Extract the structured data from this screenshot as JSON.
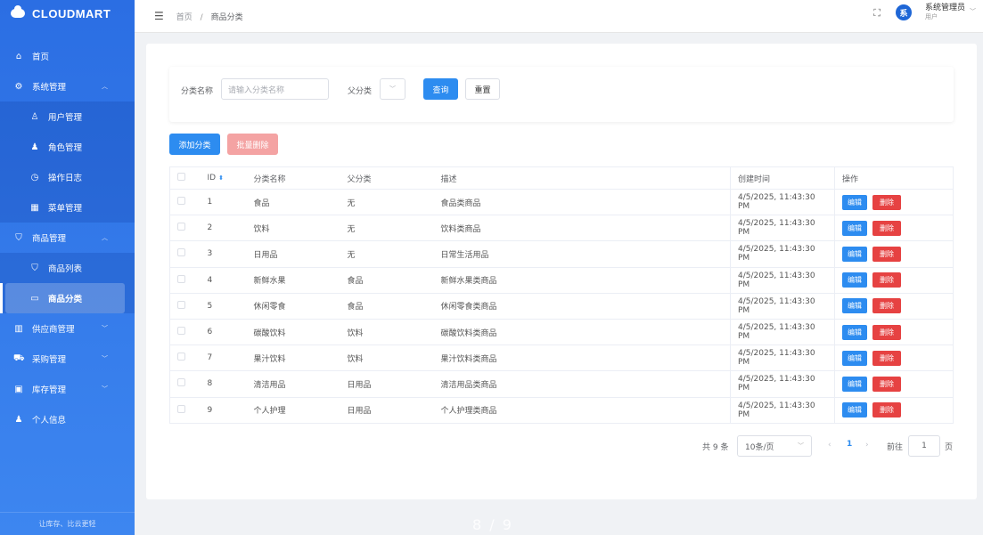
{
  "app": {
    "logo": "CLOUDMART",
    "footer": "让库存、比云更轻"
  },
  "sidebar": {
    "items": [
      {
        "label": "首页",
        "icon": "home-icon"
      },
      {
        "label": "系统管理",
        "icon": "gear-icon"
      },
      {
        "label": "用户管理",
        "icon": "user-outline-icon"
      },
      {
        "label": "角色管理",
        "icon": "user-filled-icon"
      },
      {
        "label": "操作日志",
        "icon": "timer-icon"
      },
      {
        "label": "菜单管理",
        "icon": "grid-icon"
      },
      {
        "label": "商品管理",
        "icon": "bag-icon"
      },
      {
        "label": "商品列表",
        "icon": "bag-outline-icon"
      },
      {
        "label": "商品分类",
        "icon": "folder-icon"
      },
      {
        "label": "供应商管理",
        "icon": "building-icon"
      },
      {
        "label": "采购管理",
        "icon": "cart-icon"
      },
      {
        "label": "库存管理",
        "icon": "box-icon"
      },
      {
        "label": "个人信息",
        "icon": "person-icon"
      }
    ]
  },
  "header": {
    "breadcrumb_home": "首页",
    "breadcrumb_sep": "/",
    "breadcrumb_current": "商品分类",
    "avatar_char": "系",
    "user_name": "系统管理员",
    "user_role": "用户"
  },
  "filter": {
    "name_label": "分类名称",
    "name_placeholder": "请输入分类名称",
    "parent_label": "父分类",
    "query_btn": "查询",
    "reset_btn": "重置"
  },
  "actions": {
    "add": "添加分类",
    "batch_delete": "批量删除"
  },
  "table": {
    "headers": [
      "ID",
      "分类名称",
      "父分类",
      "描述",
      "创建时间",
      "操作"
    ],
    "edit_label": "编辑",
    "delete_label": "删除",
    "rows": [
      {
        "id": "1",
        "name": "食品",
        "parent": "无",
        "desc": "食品类商品",
        "created": "4/5/2025, 11:43:30 PM"
      },
      {
        "id": "2",
        "name": "饮料",
        "parent": "无",
        "desc": "饮料类商品",
        "created": "4/5/2025, 11:43:30 PM"
      },
      {
        "id": "3",
        "name": "日用品",
        "parent": "无",
        "desc": "日常生活用品",
        "created": "4/5/2025, 11:43:30 PM"
      },
      {
        "id": "4",
        "name": "新鲜水果",
        "parent": "食品",
        "desc": "新鲜水果类商品",
        "created": "4/5/2025, 11:43:30 PM"
      },
      {
        "id": "5",
        "name": "休闲零食",
        "parent": "食品",
        "desc": "休闲零食类商品",
        "created": "4/5/2025, 11:43:30 PM"
      },
      {
        "id": "6",
        "name": "碳酸饮料",
        "parent": "饮料",
        "desc": "碳酸饮料类商品",
        "created": "4/5/2025, 11:43:30 PM"
      },
      {
        "id": "7",
        "name": "果汁饮料",
        "parent": "饮料",
        "desc": "果汁饮料类商品",
        "created": "4/5/2025, 11:43:30 PM"
      },
      {
        "id": "8",
        "name": "清洁用品",
        "parent": "日用品",
        "desc": "清洁用品类商品",
        "created": "4/5/2025, 11:43:30 PM"
      },
      {
        "id": "9",
        "name": "个人护理",
        "parent": "日用品",
        "desc": "个人护理类商品",
        "created": "4/5/2025, 11:43:30 PM"
      }
    ]
  },
  "pagination": {
    "total": "共 9 条",
    "page_size": "10条/页",
    "current": "1",
    "goto_label": "前往",
    "goto_value": "1",
    "goto_unit": "页"
  },
  "overlay_page_indicator": "8 / 9",
  "colors": {
    "primary": "#2d8cf0",
    "danger": "#e64242",
    "sidebar": "#2b6ee3"
  }
}
